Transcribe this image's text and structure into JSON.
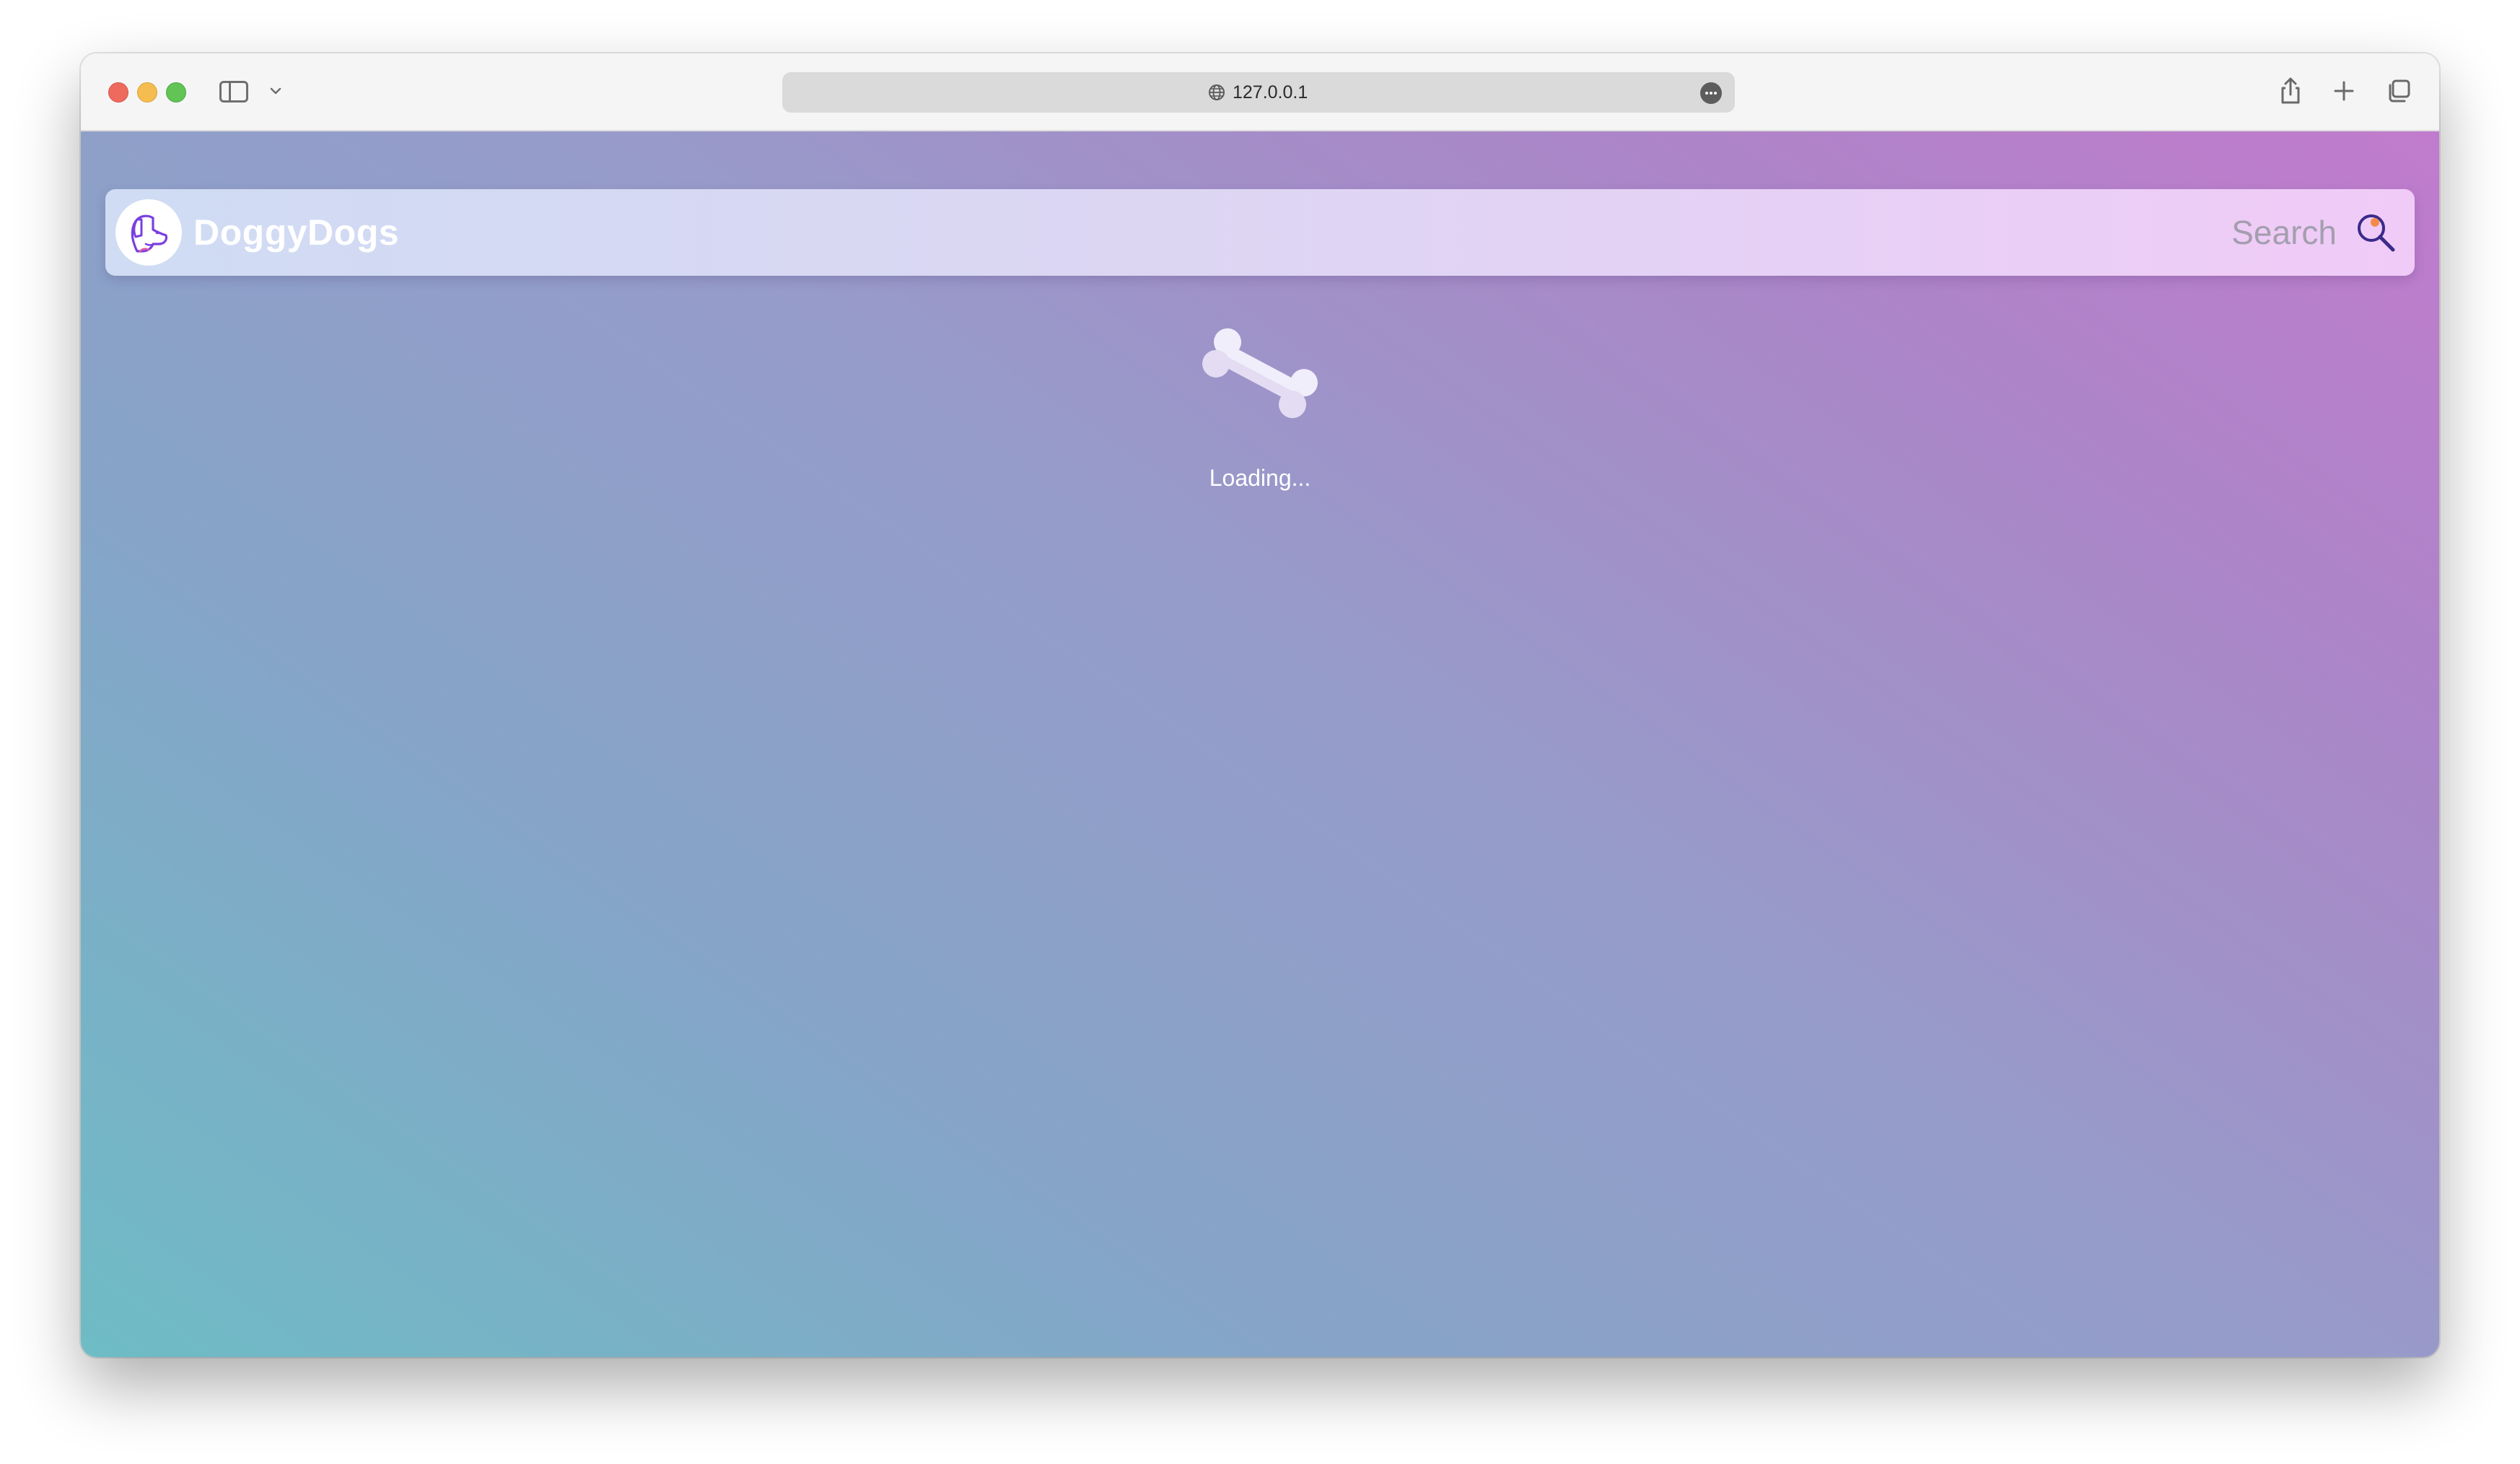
{
  "browser": {
    "url": "127.0.0.1",
    "icons": {
      "sidebar": "sidebar-icon",
      "chevron": "chevron-down-icon",
      "globe": "globe-icon",
      "more": "more-icon",
      "share": "share-icon",
      "new_tab": "plus-icon",
      "tabs": "tab-overview-icon"
    }
  },
  "navbar": {
    "brand_name": "DoggyDogs",
    "search_label": "Search",
    "logo_icon": "dog-head-icon",
    "search_icon": "magnifier-icon"
  },
  "loader": {
    "icon": "bone-icon",
    "text": "Loading..."
  },
  "colors": {
    "gradient_start": "#6ebcc5",
    "gradient_end": "#c17bcd",
    "brand_accent": "#7a3fe0",
    "search_icon_color": "#3a2a8a",
    "search_icon_dot": "#f28a4a"
  }
}
